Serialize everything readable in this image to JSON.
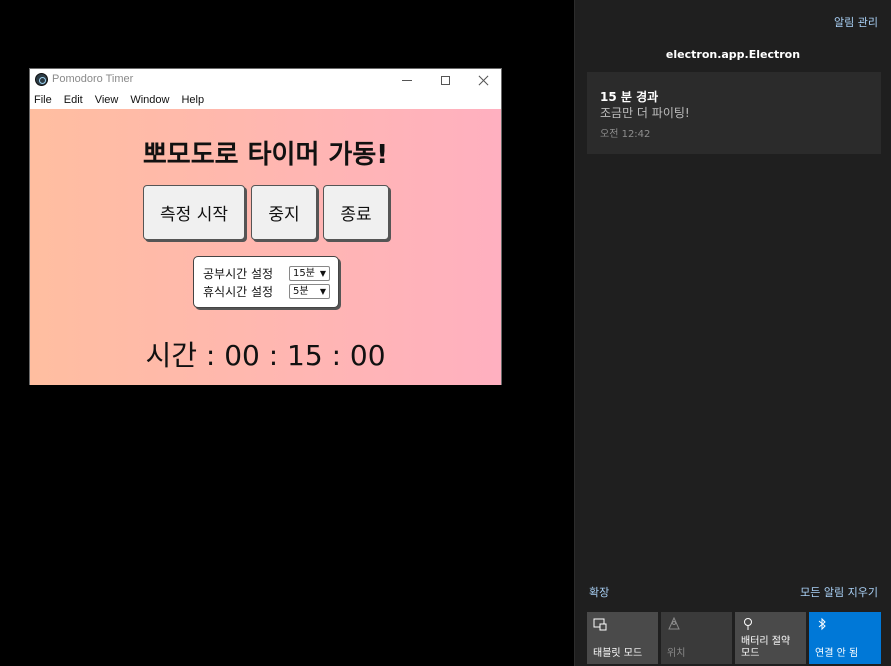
{
  "window": {
    "title": "Pomodoro Timer",
    "menu": [
      "File",
      "Edit",
      "View",
      "Window",
      "Help"
    ]
  },
  "app": {
    "heading": "뽀모도로 타이머 가동!",
    "buttons": {
      "start": "측정 시작",
      "stop": "중지",
      "end": "종료"
    },
    "settings": {
      "study_label": "공부시간 설정",
      "study_value": "15분",
      "rest_label": "휴식시간 설정",
      "rest_value": "5분"
    },
    "time": "시간 : 00 : 15 : 00"
  },
  "action_center": {
    "manage": "알림 관리",
    "app_name": "electron.app.Electron",
    "notification": {
      "title": "15 분 경과",
      "body": "조금만 더 파이팅!",
      "time": "오전 12:42"
    },
    "expand": "확장",
    "clear_all": "모든 알림 지우기",
    "tiles": {
      "tablet": "태블릿 모드",
      "location": "위치",
      "battery": "배터리 절약 모드",
      "bluetooth": "연결 안 됨"
    },
    "colors": {
      "accent": "#0078d7",
      "link": "#a9d0f5",
      "panel_bg": "#1f1f1f"
    }
  }
}
